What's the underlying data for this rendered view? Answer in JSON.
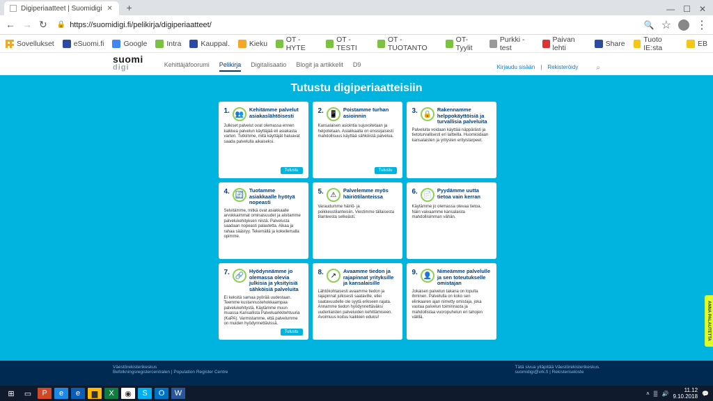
{
  "browser": {
    "tab_title": "Digiperiaatteet | Suomidigi",
    "url": "https://suomidigi.fi/pelikirja/digiperiaatteet/",
    "nav": {
      "back": "←",
      "forward": "→",
      "reload": "↻"
    },
    "win": {
      "min": "—",
      "max": "☐",
      "close": "✕"
    },
    "newtab": "+"
  },
  "bookmarks": [
    {
      "label": "Sovellukset",
      "color": "#f5a623"
    },
    {
      "label": "eSuomi.fi",
      "color": "#2b4aa0"
    },
    {
      "label": "Google",
      "color": "#4285f4"
    },
    {
      "label": "Intra",
      "color": "#7cc142"
    },
    {
      "label": "Kauppal.",
      "color": "#2b4aa0"
    },
    {
      "label": "Kieku",
      "color": "#f5a623"
    },
    {
      "label": "OT - HYTE",
      "color": "#7cc142"
    },
    {
      "label": "OT - TESTI",
      "color": "#7cc142"
    },
    {
      "label": "OT - TUOTANTO",
      "color": "#7cc142"
    },
    {
      "label": "OT-Tyylit",
      "color": "#7cc142"
    },
    {
      "label": "Purkki - test",
      "color": "#999"
    },
    {
      "label": "Paivan lehti",
      "color": "#d33"
    },
    {
      "label": "Share",
      "color": "#2b4aa0"
    },
    {
      "label": "Tuoto IE:sta",
      "color": "#f5c518"
    },
    {
      "label": "EB",
      "color": "#f5c518"
    }
  ],
  "site": {
    "logo_top": "suomi",
    "logo_bottom": "digi",
    "nav": [
      "Kehittäjäfoorumi",
      "Pelikirja",
      "Digitalisaatio",
      "Blogit ja artikkelit",
      "D9"
    ],
    "nav_active": 1,
    "login": "Kirjaudu sisään",
    "register": "Rekisteröidy",
    "heading": "Tutustu digiperiaatteisiin"
  },
  "cards": [
    {
      "n": "1.",
      "title": "Kehitämme palvelut asiakaslähtöisesti",
      "body": "Julkiset palvelut ovat olemassa ennen kaikkea palvelun käyttäjää eli asiakasta varten. Tutkimme, mitä käyttäjät haluavat saada palvelulla aikaiseksi.",
      "btn": "Tutustu"
    },
    {
      "n": "2.",
      "title": "Poistamme turhan asioinnin",
      "body": "Kansalaisen asiointia sujuvoitetaan ja helpotetaan. Asiakkaalla on ensisijaisesti mahdollisuus käyttää sähköistä palvelua.",
      "btn": "Tutustu"
    },
    {
      "n": "3.",
      "title": "Rakennamme helppokäyttöisiä ja turvallisia palveluita",
      "body": "Palveluita voidaan käyttää näppärästi ja tietoturvallisesti eri laitteilla. Huomioidaan kansalaisten ja yritysten erityistarpeet.",
      "btn": ""
    },
    {
      "n": "4.",
      "title": "Tuotamme asiakkaalle hyötyä nopeasti",
      "body": "Selvitämme, mitkä ovat asiakkaalle arvokkaimmat ominaisuudet ja aloitamme palvelukehityksen niistä. Palvelusta saadaan nopeasti palautetta. Aikaa ja rahaa säästyy. Tekemällä ja kokeilemalla opimme.",
      "btn": ""
    },
    {
      "n": "5.",
      "title": "Palvelemme myös häiriötilanteissa",
      "body": "Varaudumme häiriö- ja poikkeustilanteisiin. Viestimme tällaisesta tilanteesta selkeästi.",
      "btn": ""
    },
    {
      "n": "6.",
      "title": "Pyydämme uutta tietoa vain kerran",
      "body": "Käytämme jo olemassa olevaa tietoa. Näin vaivaamme kansalaista mahdollisimman vähän.",
      "btn": ""
    },
    {
      "n": "7.",
      "title": "Hyödynnämme jo olemassa olevia julkisia ja yksityisiä sähköisiä palveluita",
      "body": "Ei keksitä samaa pyörää uudestaan. Teemme kustannustehokkaampaa palvelukehitystä. Käytämme muun muassa Kansallista Palveluarkkitehtuuria (KaPA). Varmistamme, että palvelumme on muiden hyödynnettävissä.",
      "btn": "Tutustu"
    },
    {
      "n": "8.",
      "title": "Avaamme tiedon ja rajapinnat yrityksille ja kansalaisille",
      "body": "Lähtökohtaisesti avaamme tiedon ja rajapinnat julkisesti saataville, ellei saatavuudelle ole syytä erikseen rajata. Annamme tiedon hyödynnettäväksi uudenlaisten palveluiden kehittämiseen. Avoimuus koituu kaikkien eduksi!",
      "btn": ""
    },
    {
      "n": "9.",
      "title": "Nimeämme palvelulle ja sen toteutukselle omistajan",
      "body": "Jokaisen palvelun takana on lopulta ihminen. Palvelulla on koko sen elinkaaren ajan nimetty omistaja, joka vastaa palvelun toiminnasta ja mahdollistaa vuoropuhelun eri tahojen välillä.",
      "btn": ""
    }
  ],
  "footer": {
    "left1": "Väestörekisterikeskus",
    "left2": "Befolkningsregistercentralen | Population Register Centre",
    "right1": "Tätä sivua ylläpitää Väestörekisterikeskus.",
    "right2": "suomidigi@vrk.fi | Rekisteriseloste"
  },
  "feedback": "ANNA PALAUTETTA",
  "tray": {
    "time": "11.12",
    "date": "9.10.2018"
  }
}
